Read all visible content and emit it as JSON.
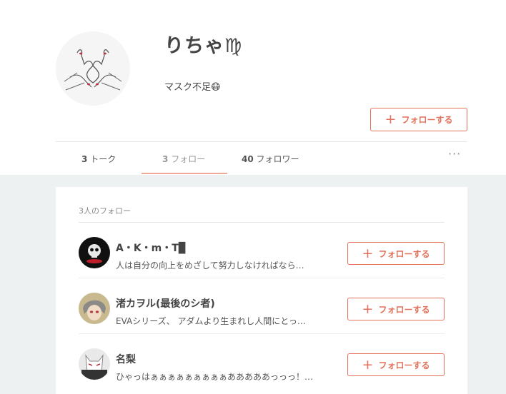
{
  "profile": {
    "name": "りちゃ♍",
    "bio": "マスク不足😷",
    "follow_label": "フォローする"
  },
  "tabs": [
    {
      "count": "3",
      "label": "トーク"
    },
    {
      "count": "3",
      "label": "フォロー"
    },
    {
      "count": "40",
      "label": "フォロワー"
    }
  ],
  "more_label": "···",
  "follow_list": {
    "title": "3人のフォロー",
    "users": [
      {
        "name": "A・K・m・T▉",
        "bio": "人は自分の向上をめざして努力しなければなら…",
        "follow_label": "フォローする"
      },
      {
        "name": "渚カヲル(最後のシ者)",
        "bio": "EVAシリーズ、 アダムより生まれし人間にとっ…",
        "follow_label": "フォローする"
      },
      {
        "name": "名梨",
        "bio": "ひゃっはぁぁぁぁぁぁぁぁぁあああああっっっ！…",
        "follow_label": "フォローする"
      }
    ]
  },
  "colors": {
    "accent": "#e2725b",
    "background": "#eef1f2"
  }
}
